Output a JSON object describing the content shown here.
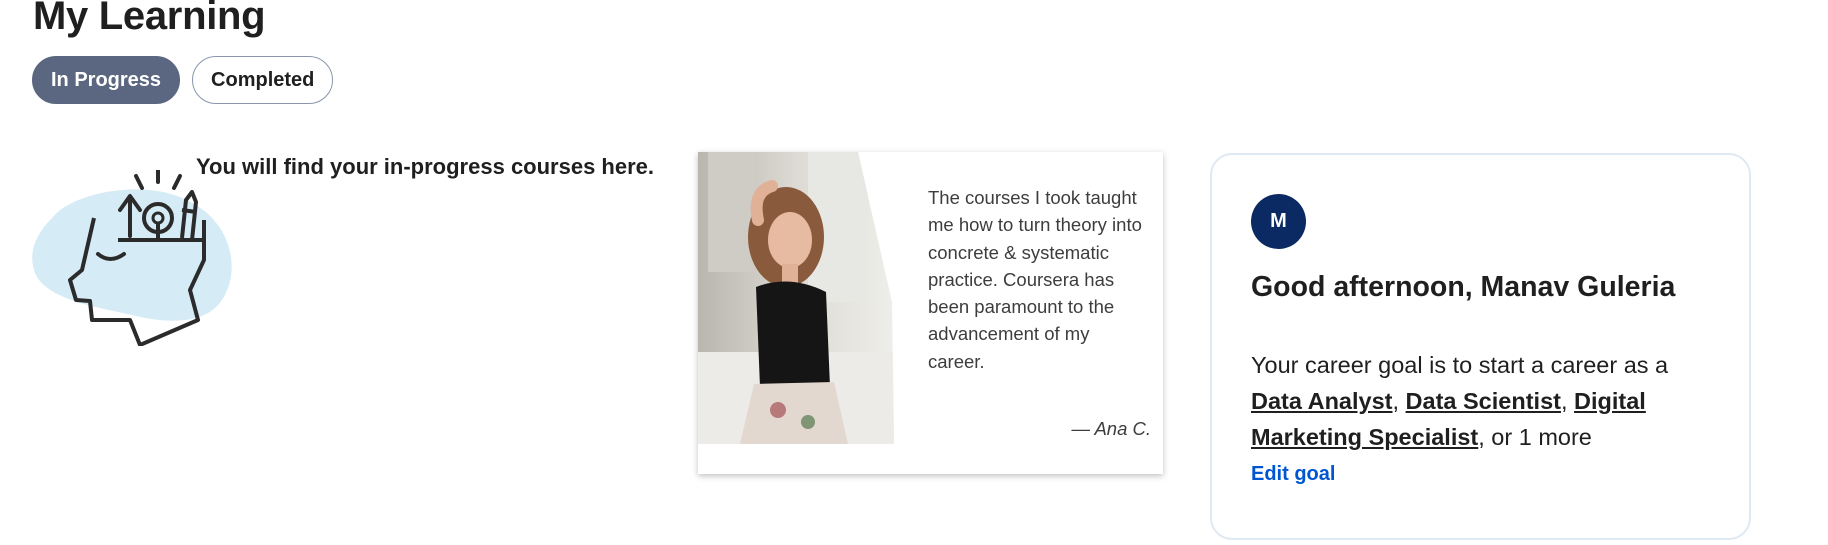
{
  "page": {
    "title": "My Learning"
  },
  "tabs": [
    {
      "label": "In Progress",
      "active": true
    },
    {
      "label": "Completed",
      "active": false
    }
  ],
  "empty_state": {
    "message": "You will find your in-progress courses here.",
    "illustration_icon": "head-lightbulb-icon"
  },
  "testimonial": {
    "quote": "The courses I took taught me how to turn theory into concrete & systematic practice. Coursera has been paramount to the advancement of my career.",
    "author": "— Ana C."
  },
  "goal_card": {
    "avatar_initial": "M",
    "greeting": "Good afternoon, Manav Guleria",
    "goal_prefix": "Your career goal is to start a career as a ",
    "careers": [
      "Data Analyst",
      "Data Scientist",
      "Digital Marketing Specialist"
    ],
    "goal_suffix": ", or 1 more",
    "edit_label": "Edit goal"
  },
  "colors": {
    "tab_active_bg": "#5b6780",
    "avatar_bg": "#0b2a63",
    "link_blue": "#0056d2",
    "illustration_blob": "#d5ebf5"
  }
}
